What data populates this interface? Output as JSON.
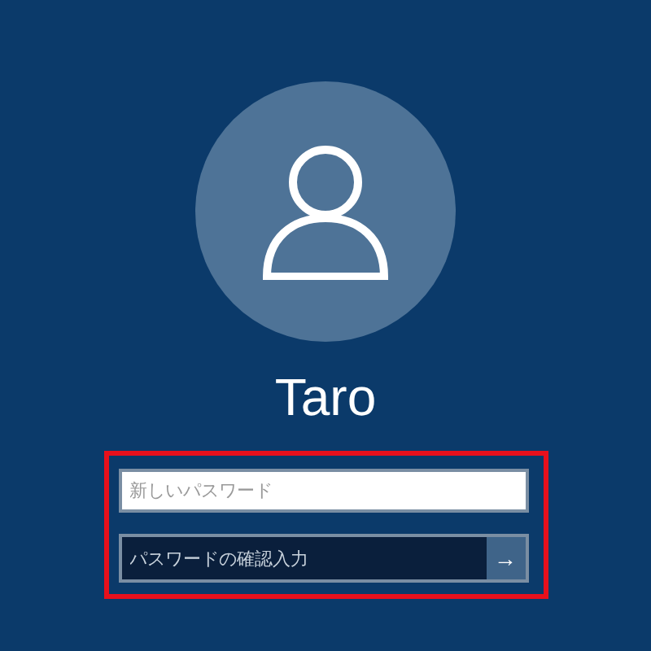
{
  "user": {
    "name": "Taro"
  },
  "fields": [
    {
      "placeholder": "新しいパスワード",
      "kind": "plain"
    },
    {
      "placeholder": "パスワードの確認入力",
      "kind": "submit",
      "button": "→"
    }
  ]
}
